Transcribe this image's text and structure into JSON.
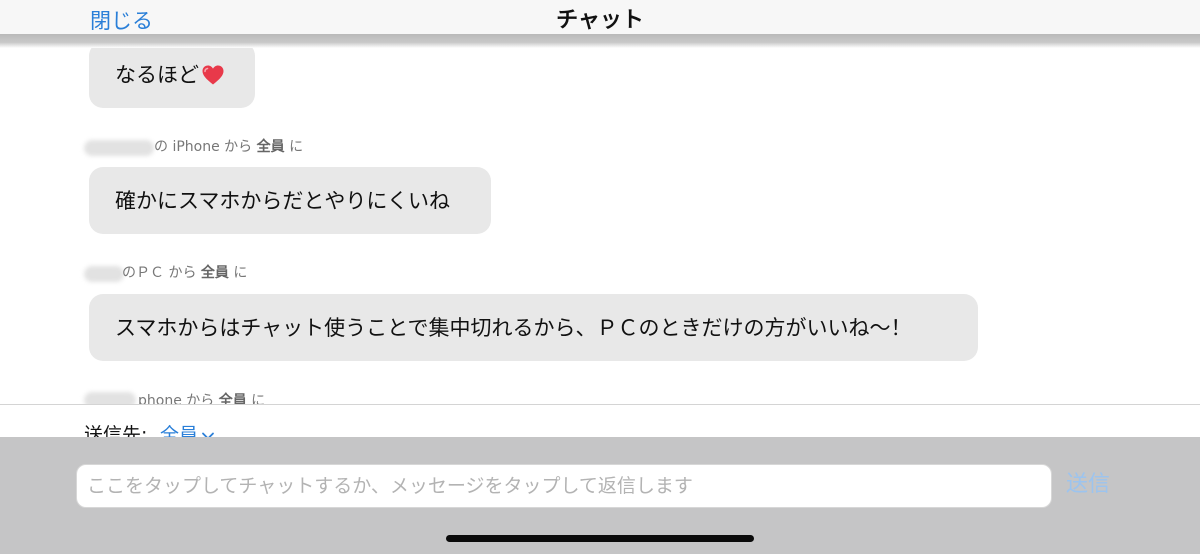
{
  "header": {
    "close_label": "閉じる",
    "title": "チャット"
  },
  "messages": [
    {
      "text": "なるほど",
      "emoji": "heart"
    },
    {
      "sender_device": "の iPhone",
      "from_word": "から",
      "to": "全員",
      "to_suffix": "に",
      "text": "確かにスマホからだとやりにくいね"
    },
    {
      "sender_device": "のＰＣ",
      "from_word": "から",
      "to": "全員",
      "to_suffix": "に",
      "text": "スマホからはチャット使うことで集中切れるから、ＰＣのときだけの方がいいね〜！"
    },
    {
      "sender_device": "phone",
      "from_word": "から",
      "to": "全員",
      "to_suffix": "に"
    }
  ],
  "recipient": {
    "label": "送信先:",
    "value": "全員"
  },
  "composer": {
    "placeholder": "ここをタップしてチャットするか、メッセージをタップして返信します",
    "value": "",
    "send_label": "送信"
  },
  "colors": {
    "accent": "#2a7fd8",
    "send_disabled": "#9cc4ef",
    "bubble": "#e8e8e8",
    "heart": "#e8394a"
  }
}
